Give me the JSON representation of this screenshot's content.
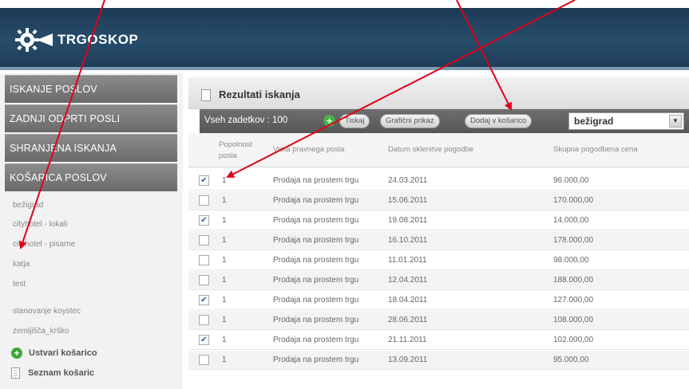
{
  "header": {
    "logo_text": "TRGOSKOP"
  },
  "sidebar": {
    "buttons": [
      "ISKANJE POSLOV",
      "ZADNJI ODPRTI POSLI",
      "SHRANJENA ISKANJA",
      "KOŠARICA POSLOV"
    ],
    "baskets": [
      "bežigrad",
      "cityhotel - lokali",
      "cityhotel - pisarne",
      "katja",
      "test",
      "stanovanje koystec",
      "zemljišča_krško"
    ],
    "create_basket": "Ustvari košarico",
    "basket_list": "Seznam košaric"
  },
  "main": {
    "title": "Rezultati iskanja",
    "toolbar": {
      "count_label": "Vseh zadetkov : 100",
      "print_btn": "Tiskaj",
      "graph_btn": "Grafični prikaz",
      "add_to_basket_btn": "Dodaj v košarico",
      "select_value": "bežigrad"
    },
    "columns": {
      "part": "Popolnost posla",
      "type": "Vrsta pravnega posla",
      "date": "Datum sklenitve pogodbe",
      "price": "Skupna pogodbena cena"
    },
    "rows": [
      {
        "checked": true,
        "part": "1",
        "type": "Prodaja na prostem trgu",
        "date": "24.03.2011",
        "price": "96.000,00"
      },
      {
        "checked": false,
        "part": "1",
        "type": "Prodaja na prostem trgu",
        "date": "15.06.2011",
        "price": "170.000,00"
      },
      {
        "checked": true,
        "part": "1",
        "type": "Prodaja na prostem trgu",
        "date": "19.08.2011",
        "price": "14.000,00"
      },
      {
        "checked": false,
        "part": "1",
        "type": "Prodaja na prostem trgu",
        "date": "16.10.2011",
        "price": "178.000,00"
      },
      {
        "checked": false,
        "part": "1",
        "type": "Prodaja na prostem trgu",
        "date": "11.01.2011",
        "price": "98.000,00"
      },
      {
        "checked": false,
        "part": "1",
        "type": "Prodaja na prostem trgu",
        "date": "12.04.2011",
        "price": "188.000,00"
      },
      {
        "checked": true,
        "part": "1",
        "type": "Prodaja na prostem trgu",
        "date": "18.04.2011",
        "price": "127.000,00"
      },
      {
        "checked": false,
        "part": "1",
        "type": "Prodaja na prostem trgu",
        "date": "28.06.2011",
        "price": "108.000,00"
      },
      {
        "checked": true,
        "part": "1",
        "type": "Prodaja na prostem trgu",
        "date": "21.11.2011",
        "price": "102.000,00"
      },
      {
        "checked": false,
        "part": "1",
        "type": "Prodaja na prostem trgu",
        "date": "13.09.2011",
        "price": "95.000,00"
      }
    ]
  },
  "colors": {
    "header_bg": "#274d6b",
    "arrow": "#e0001b",
    "toolbar_bg": "#5f5f5f"
  }
}
